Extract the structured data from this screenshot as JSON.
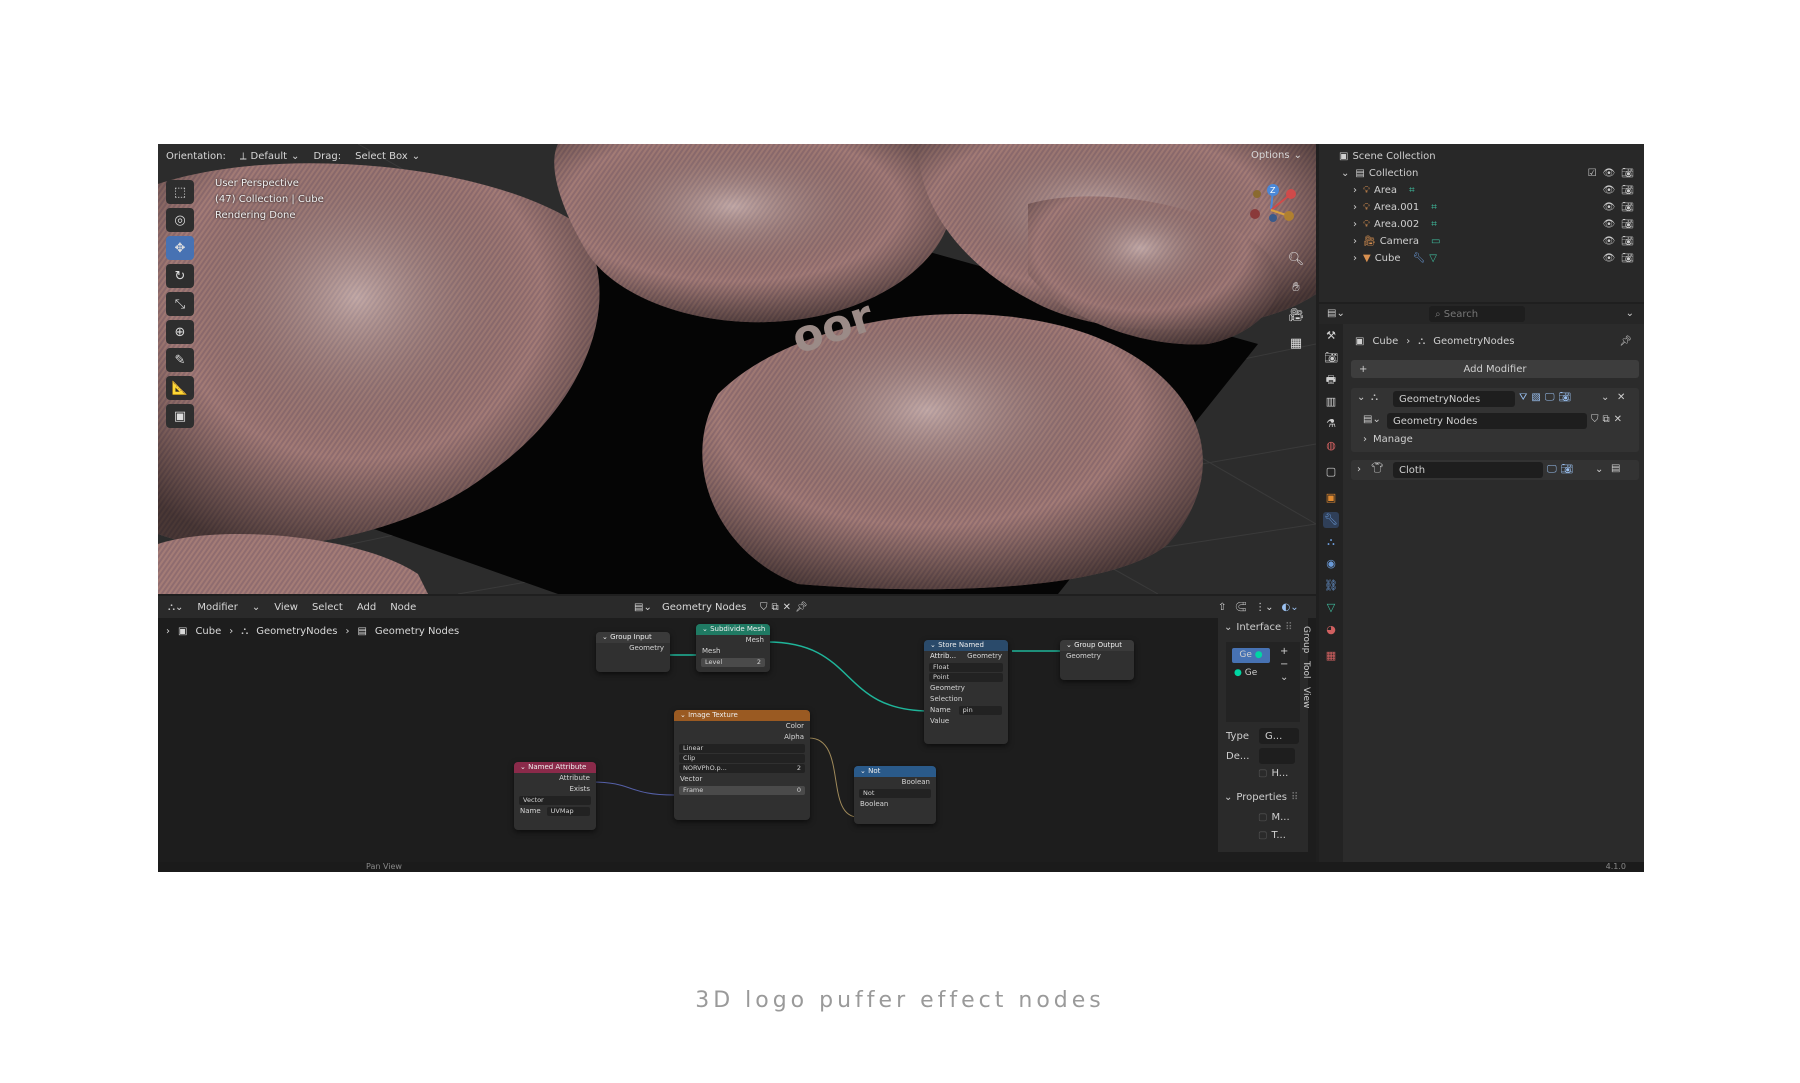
{
  "viewport": {
    "orientation_label": "Orientation:",
    "orientation_value": "Default",
    "drag_label": "Drag:",
    "drag_value": "Select Box",
    "options_label": "Options",
    "overlay": [
      "User Perspective",
      "(47) Collection | Cube",
      "Rendering Done"
    ],
    "logo_text": "oor",
    "gizmo": {
      "z": "Z"
    }
  },
  "outliner": {
    "scene_collection": "Scene Collection",
    "collection": "Collection",
    "items": [
      "Area",
      "Area.001",
      "Area.002",
      "Camera",
      "Cube"
    ]
  },
  "properties": {
    "search_placeholder": "Search",
    "breadcrumb_object": "Cube",
    "breadcrumb_modifier": "GeometryNodes",
    "add_modifier": "Add Modifier",
    "modifier_name": "GeometryNodes",
    "node_group": "Geometry Nodes",
    "manage": "Manage",
    "cloth": "Cloth"
  },
  "node_editor": {
    "menus": [
      "Modifier",
      "View",
      "Select",
      "Add",
      "Node"
    ],
    "tree_name": "Geometry Nodes",
    "breadcrumb": [
      "Cube",
      "GeometryNodes",
      "Geometry Nodes"
    ],
    "nodes": {
      "group_input": {
        "title": "Group Input",
        "geometry": "Geometry"
      },
      "subdivide": {
        "title": "Subdivide Mesh",
        "mesh_out": "Mesh",
        "mesh_in": "Mesh",
        "level_label": "Level",
        "level_value": "2"
      },
      "store": {
        "title": "Store Named Attrib...",
        "geometry_out": "Geometry",
        "type": "Float",
        "domain": "Point",
        "geometry_in": "Geometry",
        "selection": "Selection",
        "name_label": "Name",
        "name_value": "pin",
        "value": "Value"
      },
      "group_output": {
        "title": "Group Output",
        "geometry": "Geometry"
      },
      "image_texture": {
        "title": "Image Texture",
        "color": "Color",
        "alpha": "Alpha",
        "interp": "Linear",
        "extension": "Clip",
        "image": "NORVPhO.p...",
        "users": "2",
        "vector": "Vector",
        "frame_label": "Frame",
        "frame_value": "0"
      },
      "named_attr": {
        "title": "Named Attribute",
        "attribute": "Attribute",
        "exists": "Exists",
        "type": "Vector",
        "name_label": "Name",
        "name_value": "UVMap"
      },
      "not": {
        "title": "Not",
        "boolean_out": "Boolean",
        "op": "Not",
        "boolean_in": "Boolean"
      }
    },
    "panel": {
      "interface": "Interface",
      "socket_a": "Ge",
      "socket_b": "Ge",
      "type_label": "Type",
      "type_value": "G...",
      "default_label": "De...",
      "h_label": "H...",
      "properties": "Properties",
      "m_label": "M...",
      "t_label": "T..."
    },
    "side_tabs": [
      "Group",
      "Tool",
      "View"
    ]
  },
  "status": {
    "pan": "Pan View",
    "version": "4.1.0"
  },
  "caption": "3D logo puffer effect nodes",
  "colors": {
    "accent": "#4772b3",
    "geometry_socket": "#00d6a3",
    "link": "#1fb59a"
  }
}
